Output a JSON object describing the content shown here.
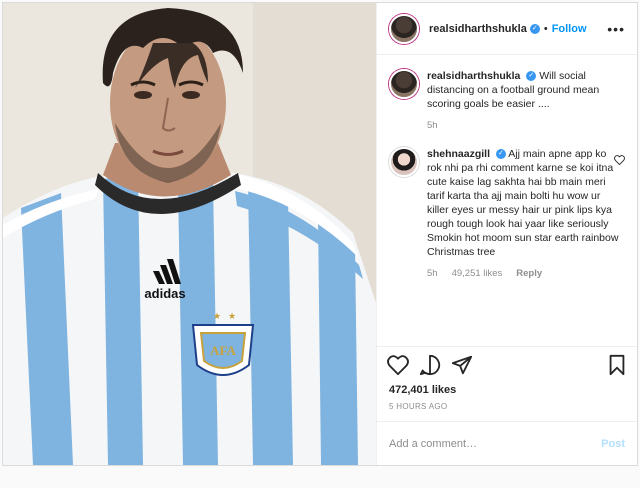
{
  "post": {
    "author": "realsidharthshukla",
    "follow_label": "Follow",
    "more_label": "•••",
    "caption": {
      "username": "realsidharthshukla",
      "text": "Will social distancing on a football ground mean scoring goals be easier ....",
      "time": "5h"
    },
    "comment": {
      "username": "shehnaazgill",
      "text": "Ajj main apne app ko rok nhi pa rhi comment karne se koi itna cute kaise lag sakhta hai  bb main meri tarif karta tha ajj main bolti hu wow  ur killer eyes ur messy hair  ur pink lips  kya rough tough look hai yaar  like seriously  Smokin hot  moom  sun star  earth  rainbow Christmas tree",
      "time": "5h",
      "likes": "49,251 likes",
      "reply_label": "Reply"
    },
    "likes_count": "472,401 likes",
    "time_ago": "5 HOURS AGO",
    "add_comment_placeholder": "Add a comment…",
    "post_button": "Post",
    "jersey_brand": "adidas",
    "crest_text": "AFA"
  },
  "colors": {
    "accent": "#0095f6",
    "jersey_blue": "#7fb3e0",
    "jersey_white": "#f4f6f8"
  }
}
